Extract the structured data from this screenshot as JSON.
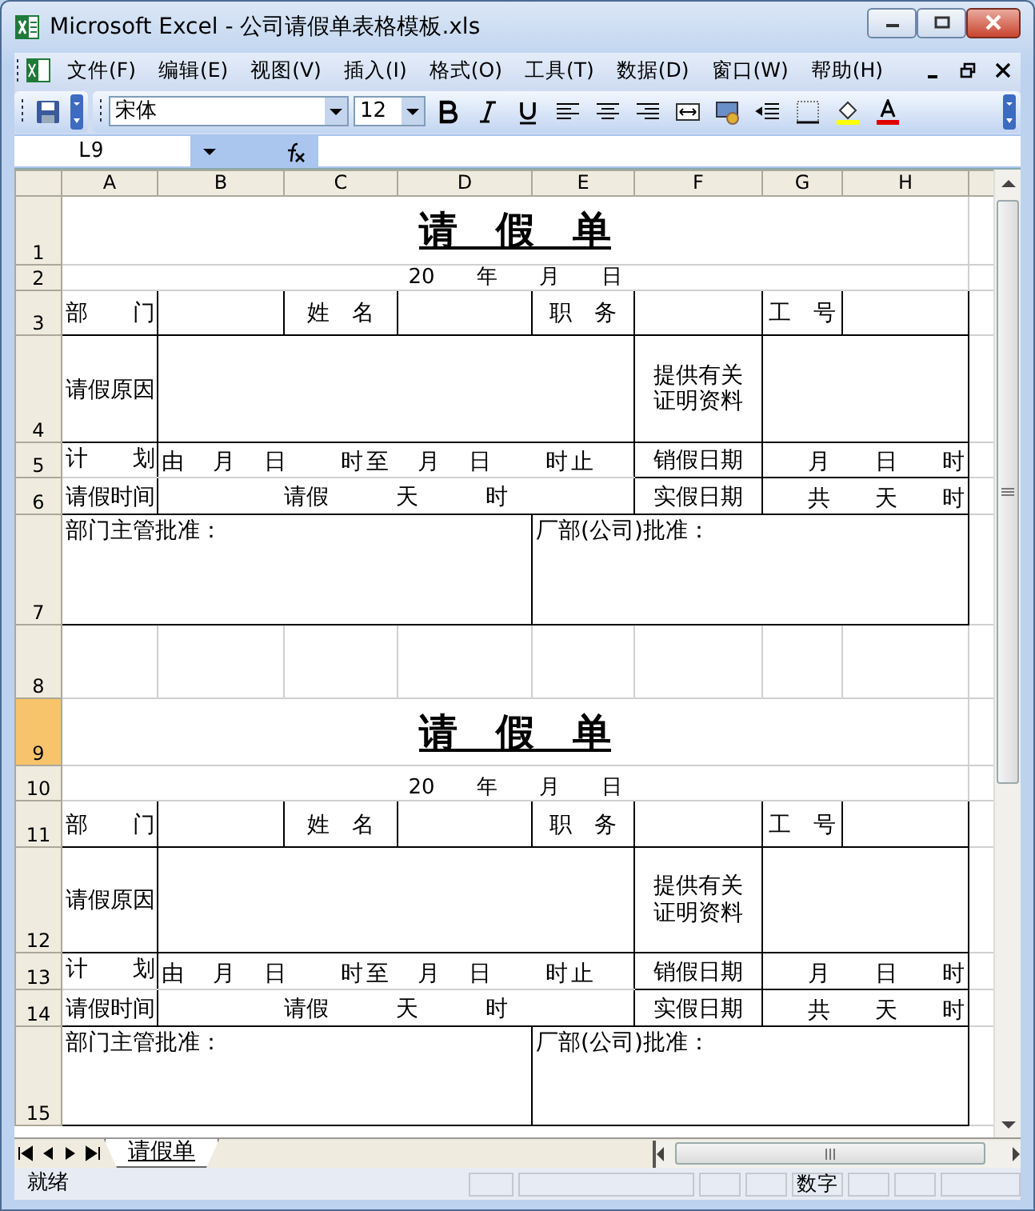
{
  "window": {
    "title": "Microsoft Excel - 公司请假单表格模板.xls"
  },
  "menu": [
    {
      "label": "文件(F)"
    },
    {
      "label": "编辑(E)"
    },
    {
      "label": "视图(V)"
    },
    {
      "label": "插入(I)"
    },
    {
      "label": "格式(O)"
    },
    {
      "label": "工具(T)"
    },
    {
      "label": "数据(D)"
    },
    {
      "label": "窗口(W)"
    },
    {
      "label": "帮助(H)"
    }
  ],
  "toolbar": {
    "font": "宋体",
    "size": "12"
  },
  "formula_bar": {
    "name_box": "L9"
  },
  "columns": [
    {
      "label": "A"
    },
    {
      "label": "B"
    },
    {
      "label": "C"
    },
    {
      "label": "D"
    },
    {
      "label": "E"
    },
    {
      "label": "F"
    },
    {
      "label": "G"
    },
    {
      "label": "H"
    }
  ],
  "rows": [
    {
      "label": "1",
      "selected": false,
      "kind": "title",
      "cells": [
        "请　假　单"
      ]
    },
    {
      "label": "2",
      "selected": false,
      "kind": "date",
      "cells": [
        "20　　年　　月　　日"
      ]
    },
    {
      "label": "3",
      "selected": false,
      "kind": "fields",
      "cells": [
        "部　　门",
        "姓　名",
        "职　务",
        "工　号"
      ]
    },
    {
      "label": "4",
      "selected": false,
      "kind": "reason",
      "cells": [
        "请假原因",
        "提供有关证明资料"
      ]
    },
    {
      "label": "5",
      "selected": false,
      "kind": "plan",
      "cells": [
        "计　　划",
        "由　月　日　　时至　月　日　　时止",
        "销假日期",
        "月　　日　　时"
      ]
    },
    {
      "label": "6",
      "selected": false,
      "kind": "duration",
      "cells": [
        "请假时间",
        "请假　　　天　　　时",
        "实假日期",
        "共　　天　　时"
      ]
    },
    {
      "label": "7",
      "selected": false,
      "kind": "approval",
      "cells": [
        "部门主管批准：",
        "厂部(公司)批准："
      ]
    },
    {
      "label": "8",
      "selected": false,
      "kind": "blank"
    },
    {
      "label": "9",
      "selected": true,
      "kind": "title",
      "cells": [
        "请　假　单"
      ]
    },
    {
      "label": "10",
      "selected": false,
      "kind": "date",
      "cells": [
        "20　　年　　月　　日"
      ]
    },
    {
      "label": "11",
      "selected": false,
      "kind": "fields",
      "cells": [
        "部　　门",
        "姓　名",
        "职　务",
        "工　号"
      ]
    },
    {
      "label": "12",
      "selected": false,
      "kind": "reason",
      "cells": [
        "请假原因",
        "提供有关证明资料"
      ]
    },
    {
      "label": "13",
      "selected": false,
      "kind": "plan",
      "cells": [
        "计　　划",
        "由　月　日　　时至　月　日　　时止",
        "销假日期",
        "月　　日　　时"
      ]
    },
    {
      "label": "14",
      "selected": false,
      "kind": "duration",
      "cells": [
        "请假时间",
        "请假　　　天　　　时",
        "实假日期",
        "共　　天　　时"
      ]
    },
    {
      "label": "15",
      "selected": false,
      "kind": "approval",
      "cells": [
        "部门主管批准：",
        "厂部(公司)批准："
      ]
    }
  ],
  "sheet_tabs": [
    {
      "label": "请假单",
      "selected": true
    }
  ],
  "status_bar": {
    "message": "就绪",
    "indicators": [
      {
        "text": "数字"
      }
    ]
  }
}
